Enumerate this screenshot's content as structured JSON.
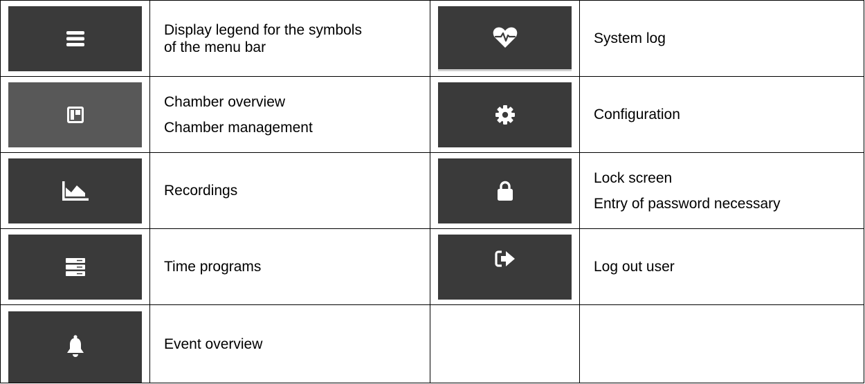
{
  "rows": [
    {
      "left_icon": "menu-icon",
      "left_lines": [
        "Display legend for the symbols",
        "of the menu bar"
      ],
      "right_icon": "heart-pulse-icon",
      "right_lines": [
        "System log"
      ]
    },
    {
      "left_icon": "chamber-overview-icon",
      "left_lines": [
        "Chamber overview",
        "Chamber management"
      ],
      "right_icon": "gear-icon",
      "right_lines": [
        "Configuration"
      ]
    },
    {
      "left_icon": "area-chart-icon",
      "left_lines": [
        "Recordings"
      ],
      "right_icon": "lock-icon",
      "right_lines": [
        "Lock screen",
        "Entry of password necessary"
      ]
    },
    {
      "left_icon": "server-icon",
      "left_lines": [
        "Time programs"
      ],
      "right_icon": "logout-icon",
      "right_lines": [
        "Log out user"
      ]
    },
    {
      "left_icon": "bell-icon",
      "left_lines": [
        "Event overview"
      ]
    }
  ],
  "colors": {
    "button_bg": "#3a3a3a",
    "button_bg_active": "#585858",
    "icon": "#ffffff",
    "border": "#000000"
  }
}
